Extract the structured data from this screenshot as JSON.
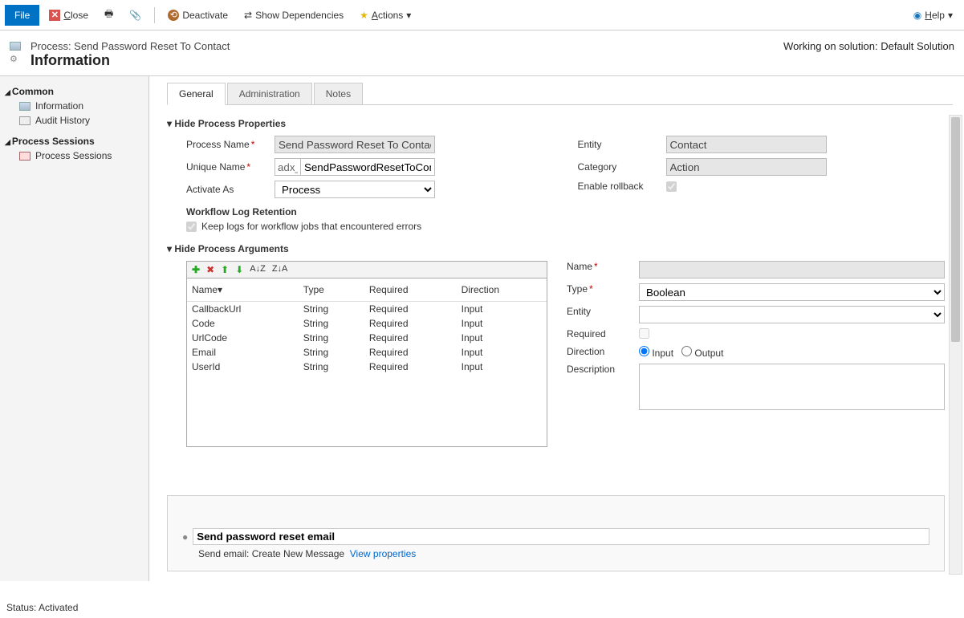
{
  "toolbar": {
    "file": "File",
    "close": "Close",
    "deactivate": "Deactivate",
    "show_deps": "Show Dependencies",
    "actions": "Actions",
    "help": "Help"
  },
  "header": {
    "process_label": "Process: Send Password Reset To Contact",
    "page_title": "Information",
    "solution": "Working on solution: Default Solution"
  },
  "sidebar": {
    "group1": "Common",
    "items1": [
      "Information",
      "Audit History"
    ],
    "group2": "Process Sessions",
    "items2": [
      "Process Sessions"
    ]
  },
  "tabs": [
    "General",
    "Administration",
    "Notes"
  ],
  "prop_section": "Hide Process Properties",
  "props": {
    "process_name_label": "Process Name",
    "process_name": "Send Password Reset To Contact",
    "unique_name_label": "Unique Name",
    "unique_prefix": "adx_",
    "unique_name": "SendPasswordResetToContact",
    "activate_as_label": "Activate As",
    "activate_as": "Process",
    "entity_label": "Entity",
    "entity": "Contact",
    "category_label": "Category",
    "category": "Action",
    "rollback_label": "Enable rollback",
    "log_header": "Workflow Log Retention",
    "log_chk": "Keep logs for workflow jobs that encountered errors"
  },
  "args_section": "Hide Process Arguments",
  "args_cols": {
    "name": "Name",
    "type": "Type",
    "required": "Required",
    "direction": "Direction"
  },
  "args_rows": [
    {
      "name": "CallbackUrl",
      "type": "String",
      "required": "Required",
      "direction": "Input"
    },
    {
      "name": "Code",
      "type": "String",
      "required": "Required",
      "direction": "Input"
    },
    {
      "name": "UrlCode",
      "type": "String",
      "required": "Required",
      "direction": "Input"
    },
    {
      "name": "Email",
      "type": "String",
      "required": "Required",
      "direction": "Input"
    },
    {
      "name": "UserId",
      "type": "String",
      "required": "Required",
      "direction": "Input"
    }
  ],
  "arg_detail": {
    "name_label": "Name",
    "type_label": "Type",
    "type_value": "Boolean",
    "entity_label": "Entity",
    "required_label": "Required",
    "direction_label": "Direction",
    "direction_input": "Input",
    "direction_output": "Output",
    "description_label": "Description"
  },
  "step": {
    "title": "Send password reset email",
    "text": "Send email:  Create New Message",
    "link": "View properties"
  },
  "status": "Status: Activated"
}
